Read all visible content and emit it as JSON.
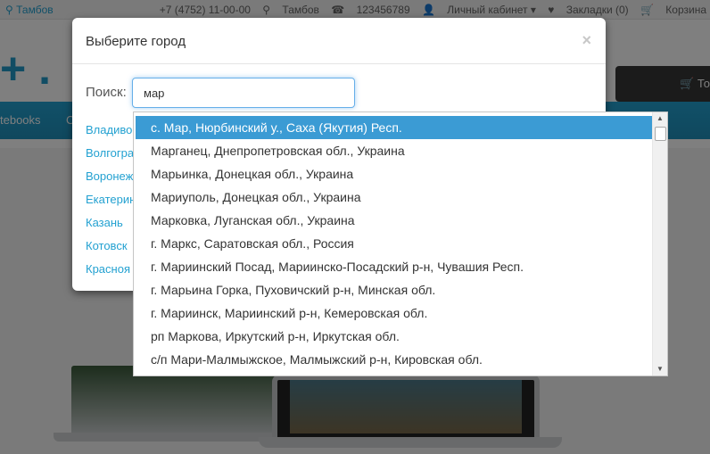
{
  "topbar": {
    "city": "Тамбов",
    "phone": "+7 (4752) 11-00-00",
    "city2": "Тамбов",
    "phone2": "123456789",
    "account": "Личный кабинет",
    "wishlist": "Закладки (0)",
    "cart": "Корзина"
  },
  "header": {
    "cart_button": "Тов"
  },
  "menu": {
    "items": [
      "tebooks",
      "C"
    ]
  },
  "modal": {
    "title": "Выберите город",
    "close_label": "×",
    "search_label": "Поиск:",
    "search_value": "мар",
    "cities": [
      "Владивос",
      "Волгогра",
      "Воронеж",
      "Екатерин",
      "Казань",
      "Котовск",
      "Красноя"
    ]
  },
  "autocomplete": {
    "items": [
      "с. Мар, Нюрбинский у., Саха (Якутия) Респ.",
      "Марганец, Днепропетровская обл., Украина",
      "Марьинка, Донецкая обл., Украина",
      "Мариуполь, Донецкая обл., Украина",
      "Марковка, Луганская обл., Украина",
      "г. Маркс, Саратовская обл., Россия",
      "г. Мариинский Посад, Мариинско-Посадский р-н, Чувашия Респ.",
      "г. Марьина Горка, Пуховичский р-н, Минская обл.",
      "г. Мариинск, Мариинский р-н, Кемеровская обл.",
      "рп Маркова, Иркутский р-н, Иркутская обл.",
      "с/п Мари-Малмыжское, Малмыжский р-н, Кировская обл."
    ],
    "active_index": 0
  },
  "colors": {
    "accent": "#23a1d1",
    "highlight": "#3b9bd4"
  }
}
